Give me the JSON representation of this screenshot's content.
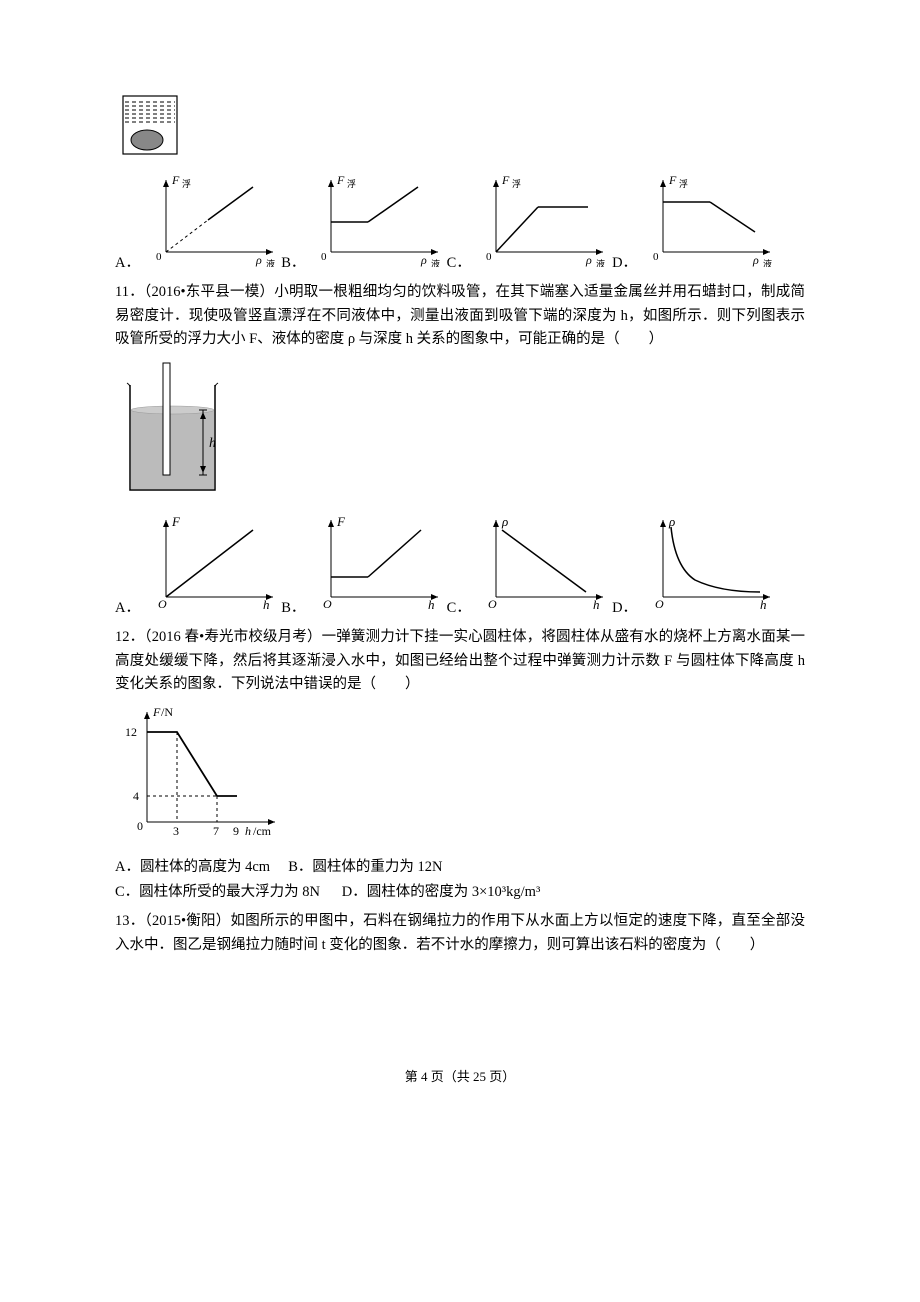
{
  "q10": {
    "options_labels": [
      "A．",
      "B．",
      "C．",
      "D．"
    ]
  },
  "q11": {
    "text": "11．（2016•东平县一模）小明取一根粗细均匀的饮料吸管，在其下端塞入适量金属丝并用石蜡封口，制成简易密度计．现使吸管竖直漂浮在不同液体中，测量出液面到吸管下端的深度为 h，如图所示．则下列图表示吸管所受的浮力大小 F、液体的密度 ρ 与深度 h 关系的图象中，可能正确的是（　　）",
    "options_labels": [
      "A．",
      "B．",
      "C．",
      "D．"
    ]
  },
  "q12": {
    "text": "12．（2016 春•寿光市校级月考）一弹簧测力计下挂一实心圆柱体，将圆柱体从盛有水的烧杯上方离水面某一高度处缓缓下降，然后将其逐渐浸入水中，如图已经给出整个过程中弹簧测力计示数 F 与圆柱体下降高度 h 变化关系的图象．下列说法中错误的是（　　）",
    "optA": "A．圆柱体的高度为 4cm",
    "optB": "B．圆柱体的重力为 12N",
    "optC": "C．圆柱体所受的最大浮力为 8N",
    "optD": "D．圆柱体的密度为 3×10³kg/m³"
  },
  "q13": {
    "text": "13．（2015•衡阳）如图所示的甲图中，石料在钢绳拉力的作用下从水面上方以恒定的速度下降，直至全部没入水中．图乙是钢绳拉力随时间 t 变化的图象．若不计水的摩擦力，则可算出该石料的密度为（　　）"
  },
  "footer": {
    "page_text": "第 4 页（共 25 页）"
  },
  "chart_data": [
    {
      "id": "q10-beaker",
      "type": "diagram",
      "description": "Beaker with liquid; dark oval object submerged at bottom"
    },
    {
      "id": "q10-A",
      "type": "line",
      "xlabel": "ρ_液",
      "ylabel": "F_浮",
      "description": "Dashed line from origin rising, then solid line continues rising with same slope (linear increasing throughout)",
      "segments": [
        {
          "style": "dashed",
          "x": [
            0,
            0.5
          ],
          "y": [
            0,
            0.5
          ]
        },
        {
          "style": "solid",
          "x": [
            0.5,
            1
          ],
          "y": [
            0.5,
            1
          ]
        }
      ]
    },
    {
      "id": "q10-B",
      "type": "line",
      "xlabel": "ρ_液",
      "ylabel": "F_浮",
      "description": "Horizontal constant, then rises linearly",
      "segments": [
        {
          "style": "solid",
          "x": [
            0,
            0.4
          ],
          "y": [
            0.5,
            0.5
          ]
        },
        {
          "style": "solid",
          "x": [
            0.4,
            1
          ],
          "y": [
            0.5,
            1
          ]
        }
      ]
    },
    {
      "id": "q10-C",
      "type": "line",
      "xlabel": "ρ_液",
      "ylabel": "F_浮",
      "description": "Rises linearly from origin then becomes horizontal constant",
      "segments": [
        {
          "style": "solid",
          "x": [
            0,
            0.5
          ],
          "y": [
            0,
            0.6
          ]
        },
        {
          "style": "solid",
          "x": [
            0.5,
            1
          ],
          "y": [
            0.6,
            0.6
          ]
        }
      ]
    },
    {
      "id": "q10-D",
      "type": "line",
      "xlabel": "ρ_液",
      "ylabel": "F_浮",
      "description": "Horizontal constant, then decreases linearly",
      "segments": [
        {
          "style": "solid",
          "x": [
            0,
            0.5
          ],
          "y": [
            0.7,
            0.7
          ]
        },
        {
          "style": "solid",
          "x": [
            0.5,
            1
          ],
          "y": [
            0.7,
            0.3
          ]
        }
      ]
    },
    {
      "id": "q11-beaker",
      "type": "diagram",
      "description": "Beaker with liquid; thin vertical tube (straw) floats vertically; h marked as depth from liquid surface to bottom end of tube"
    },
    {
      "id": "q11-A",
      "type": "line",
      "xlabel": "h",
      "ylabel": "F",
      "description": "Linear increasing from origin",
      "segments": [
        {
          "style": "solid",
          "x": [
            0,
            1
          ],
          "y": [
            0,
            1
          ]
        }
      ]
    },
    {
      "id": "q11-B",
      "type": "line",
      "xlabel": "h",
      "ylabel": "F",
      "description": "Horizontal then rises linearly",
      "segments": [
        {
          "style": "solid",
          "x": [
            0,
            0.4
          ],
          "y": [
            0.3,
            0.3
          ]
        },
        {
          "style": "solid",
          "x": [
            0.4,
            1
          ],
          "y": [
            0.3,
            1
          ]
        }
      ]
    },
    {
      "id": "q11-C",
      "type": "line",
      "xlabel": "h",
      "ylabel": "ρ",
      "description": "Decreasing straight line from high y-intercept to zero; does not touch axes",
      "segments": [
        {
          "style": "solid",
          "x": [
            0.05,
            0.95
          ],
          "y": [
            0.95,
            0.05
          ]
        }
      ]
    },
    {
      "id": "q11-D",
      "type": "line",
      "xlabel": "h",
      "ylabel": "ρ",
      "description": "Hyperbola-like decreasing curve (inverse relation), asymptotic",
      "segments": [
        {
          "style": "curve",
          "description": "reciprocal curve"
        }
      ]
    },
    {
      "id": "q12-graph",
      "type": "line",
      "xlabel": "h/cm",
      "ylabel": "F/N",
      "x_ticks": [
        3,
        7,
        9
      ],
      "y_ticks": [
        0,
        4,
        12
      ],
      "description": "F=12 for h in [0,3]; linear decrease from (3,12) to (7,4); F=4 for h in [7,9]; dashed guides at y=4, x=3, x=7",
      "segments": [
        {
          "x": [
            0,
            3
          ],
          "y": [
            12,
            12
          ]
        },
        {
          "x": [
            3,
            7
          ],
          "y": [
            12,
            4
          ]
        },
        {
          "x": [
            7,
            9
          ],
          "y": [
            4,
            4
          ]
        }
      ]
    }
  ]
}
